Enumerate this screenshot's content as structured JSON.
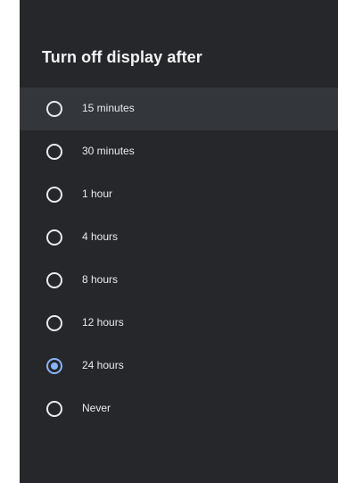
{
  "dialog": {
    "title": "Turn off display after",
    "options": [
      {
        "label": "15 minutes",
        "selected": false,
        "focused": true
      },
      {
        "label": "30 minutes",
        "selected": false,
        "focused": false
      },
      {
        "label": "1 hour",
        "selected": false,
        "focused": false
      },
      {
        "label": "4 hours",
        "selected": false,
        "focused": false
      },
      {
        "label": "8 hours",
        "selected": false,
        "focused": false
      },
      {
        "label": "12 hours",
        "selected": false,
        "focused": false
      },
      {
        "label": "24 hours",
        "selected": true,
        "focused": false
      },
      {
        "label": "Never",
        "selected": false,
        "focused": false
      }
    ]
  },
  "colors": {
    "panel_background": "#25272a",
    "focused_row": "#33363a",
    "radio_accent": "#8ab4f8",
    "text": "#e8eaed"
  },
  "icons": {
    "radio_unchecked": "radio-unchecked-icon",
    "radio_checked": "radio-checked-icon"
  }
}
